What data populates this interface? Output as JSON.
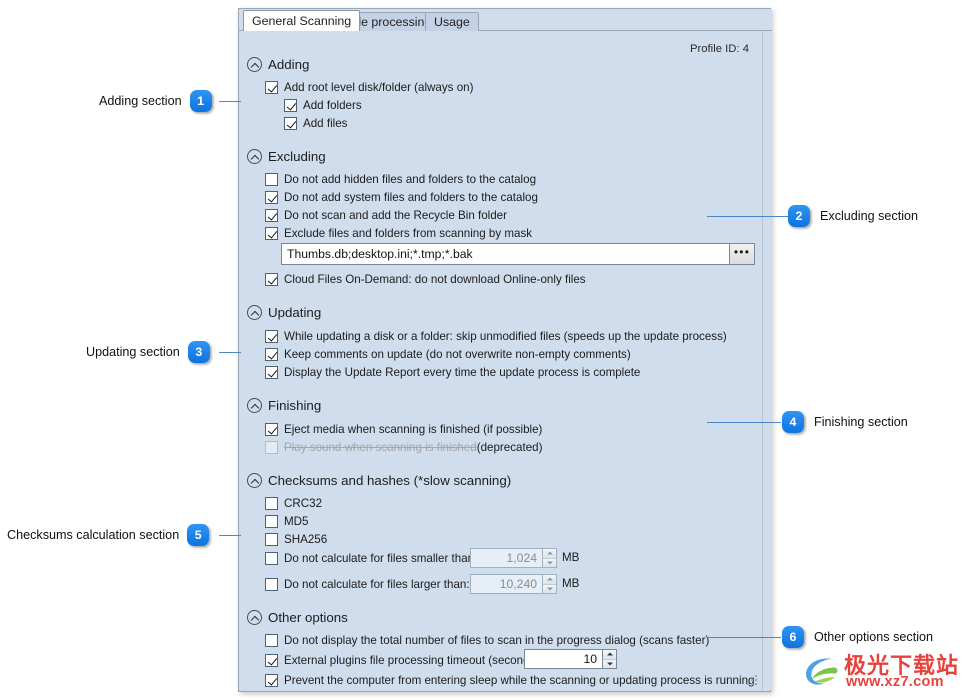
{
  "window": {
    "profile_id_label": "Profile ID: 4"
  },
  "tabs": [
    {
      "label": "General Scanning",
      "active": true
    },
    {
      "label": "File processing",
      "active": false
    },
    {
      "label": "Usage",
      "active": false
    }
  ],
  "sections": {
    "adding": {
      "title": "Adding",
      "options": [
        {
          "label": "Add root level disk/folder (always on)",
          "checked": true
        },
        {
          "label": "Add folders",
          "checked": true
        },
        {
          "label": "Add files",
          "checked": true
        }
      ]
    },
    "excluding": {
      "title": "Excluding",
      "options": [
        {
          "label": "Do not add hidden files and folders to the catalog",
          "checked": false
        },
        {
          "label": "Do not add system files and folders to the catalog",
          "checked": true
        },
        {
          "label": "Do not scan and add the Recycle Bin folder",
          "checked": true
        },
        {
          "label": "Exclude files and folders from scanning by mask",
          "checked": true
        },
        {
          "label": "Cloud Files On-Demand: do not download Online-only files",
          "checked": true
        }
      ],
      "mask_value": "Thumbs.db;desktop.ini;*.tmp;*.bak",
      "mask_placeholder": "",
      "browse_label": "•••"
    },
    "updating": {
      "title": "Updating",
      "options": [
        {
          "label": "While updating a disk or a folder: skip unmodified files (speeds up the update process)",
          "checked": true
        },
        {
          "label": "Keep comments on update (do not overwrite non-empty comments)",
          "checked": true
        },
        {
          "label": "Display the Update Report every time the update process is complete",
          "checked": true
        }
      ]
    },
    "finishing": {
      "title": "Finishing",
      "options": [
        {
          "label": "Eject media when scanning is finished (if possible)",
          "checked": true,
          "disabled": false
        },
        {
          "label": "Play sound when scanning is finished",
          "suffix": " (deprecated)",
          "checked": false,
          "disabled": true
        }
      ]
    },
    "checksums": {
      "title": "Checksums and hashes (*slow scanning)",
      "options": [
        {
          "label": "CRC32",
          "checked": false
        },
        {
          "label": "MD5",
          "checked": false
        },
        {
          "label": "SHA256",
          "checked": false
        },
        {
          "label": "Do not calculate for files smaller than:",
          "checked": false
        },
        {
          "label": "Do not calculate for files larger than:",
          "checked": false
        }
      ],
      "smaller_value": "1,024",
      "smaller_unit": "MB",
      "larger_value": "10,240",
      "larger_unit": "MB"
    },
    "other": {
      "title": "Other options",
      "options": [
        {
          "label": "Do not display the total number of files to scan in the progress dialog (scans faster)",
          "checked": false
        },
        {
          "label": "External plugins file processing timeout (seconds):",
          "checked": true
        },
        {
          "label": "Prevent the computer from entering sleep while the scanning or updating process is running",
          "checked": true
        }
      ],
      "timeout_value": "10"
    }
  },
  "annotations": [
    {
      "number": "1",
      "text": "Adding section",
      "side": "left"
    },
    {
      "number": "2",
      "text": "Excluding section",
      "side": "right"
    },
    {
      "number": "3",
      "text": "Updating section",
      "side": "left"
    },
    {
      "number": "4",
      "text": "Finishing section",
      "side": "right"
    },
    {
      "number": "5",
      "text": "Checksums calculation section",
      "side": "left"
    },
    {
      "number": "6",
      "text": "Other options section",
      "side": "right"
    }
  ],
  "watermark": {
    "name_cn": "极光下载站",
    "url": "www.xz7.com"
  },
  "colors": {
    "panel_bg": "#cfdded",
    "accent": "#0d74e0",
    "leader_line": "#4a86c8",
    "watermark_red": "#e8423c"
  }
}
